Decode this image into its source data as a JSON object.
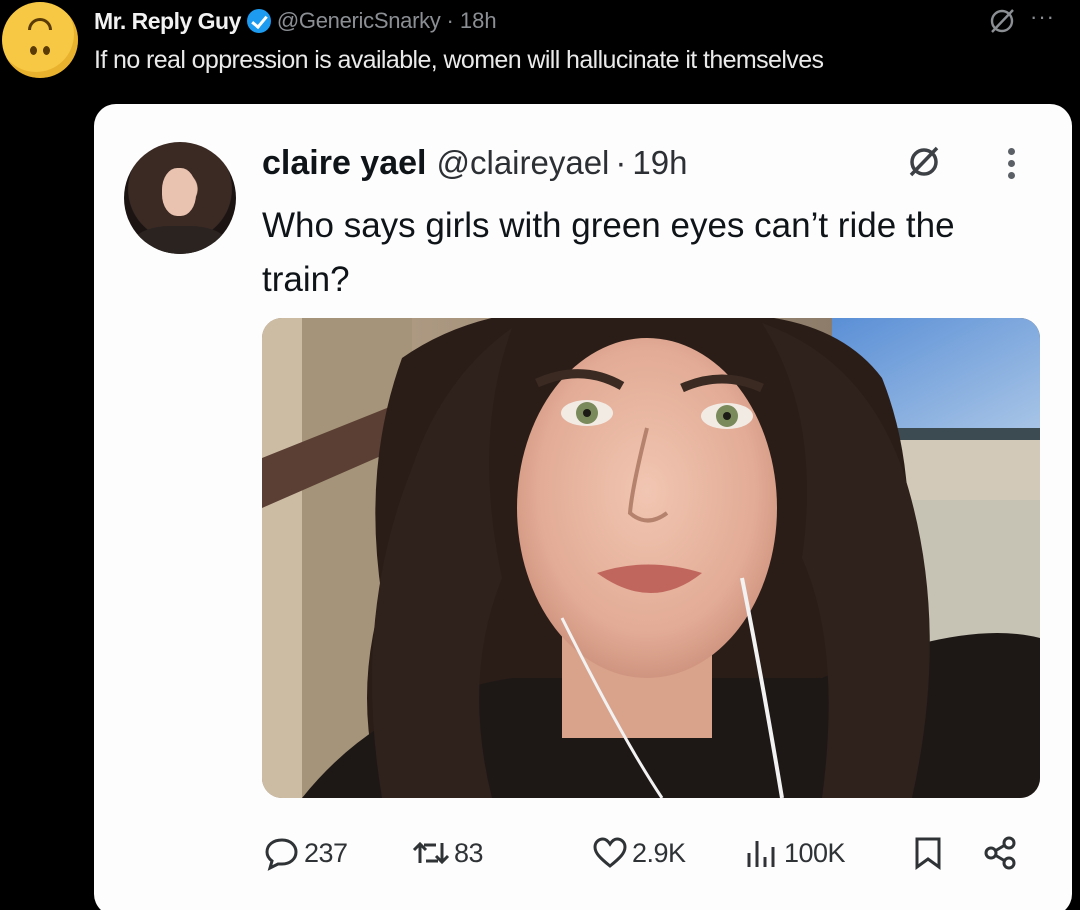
{
  "outer_tweet": {
    "author_name": "Mr. Reply Guy",
    "handle": "@GenericSnarky",
    "separator": "·",
    "time": "18h",
    "more": "···",
    "text": "If no real oppression is available, women will hallucinate it themselves",
    "avatar_icon": "upside-down-face-emoji-icon"
  },
  "quoted_tweet": {
    "author_name": "claire yael",
    "handle": "@claireyael",
    "separator": "·",
    "time": "19h",
    "text": "Who says girls with green eyes can’t ride the train?",
    "image_alt": "selfie of a woman with green eyes on a train"
  },
  "actions": {
    "replies": "237",
    "reposts": "83",
    "likes": "2.9K",
    "views": "100K"
  },
  "colors": {
    "background": "#000000",
    "card": "#fdfdfd",
    "verified": "#1d9bf0",
    "muted": "#8b8f94"
  }
}
